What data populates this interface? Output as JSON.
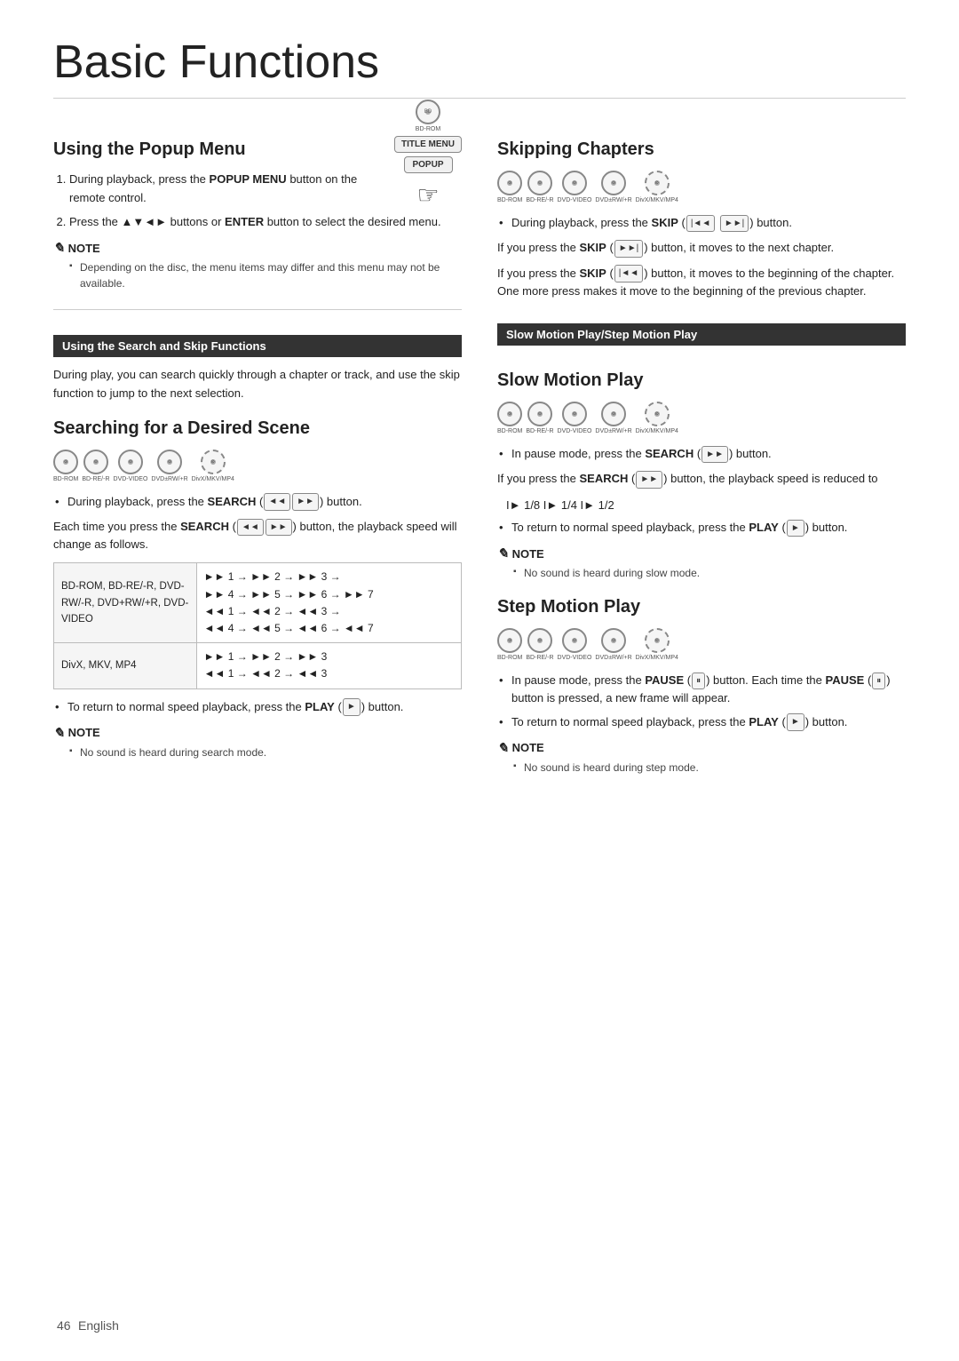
{
  "page": {
    "title": "Basic Functions",
    "footer_page": "46",
    "footer_lang": "English"
  },
  "left": {
    "popup_title": "Using the Popup Menu",
    "popup_steps": [
      {
        "num": "1.",
        "text_before": "During playback, press the ",
        "bold": "POPUP MENU",
        "text_after": " button on the remote control."
      },
      {
        "num": "2.",
        "text_before": "Press the ▲▼◄► buttons or ",
        "bold": "ENTER",
        "text_after": " button to select the desired menu."
      }
    ],
    "popup_note_label": "NOTE",
    "popup_note": "Depending on the disc, the menu items may differ and this menu may not be available.",
    "search_skip_header": "Using the Search and Skip Functions",
    "search_skip_body": "During play, you can search quickly through a chapter or track, and use the skip function to jump to the next selection.",
    "search_title": "Searching for a Desired Scene",
    "search_bullet1_before": "During playback, press the ",
    "search_bullet1_bold": "SEARCH",
    "search_bullet1_after": " (    ) button.",
    "search_each_before": "Each time you press the ",
    "search_each_bold": "SEARCH",
    "search_each_after": " (    ) button, the playback speed will change as follows.",
    "search_table": {
      "row1_label": "BD-ROM, BD-RE/-R, DVD-RW/-R, DVD+RW/+R, DVD-VIDEO",
      "row1_val": "►► 1 → ►► 2 → ►► 3 →\n►► 4 → ►► 5 → ►► 6 → ►► 7\n◄◄ 1 → ◄◄ 2 → ◄◄ 3 →\n◄◄ 4 → ◄◄ 5 → ◄◄ 6 → ◄◄ 7",
      "row2_label": "DivX, MKV, MP4",
      "row2_val": "►► 1 → ►► 2 → ►► 3\n◄◄ 1 → ◄◄ 2 → ◄◄ 3"
    },
    "search_return_before": "To return to normal speed playback, press the ",
    "search_return_bold": "PLAY",
    "search_return_after": " (    ) button.",
    "search_note_label": "NOTE",
    "search_note": "No sound is heard during search mode.",
    "remote_btn1": "TITLE MENU",
    "remote_btn2": "POPUP"
  },
  "right": {
    "skip_title": "Skipping Chapters",
    "skip_bullet1_before": "During playback, press the ",
    "skip_bullet1_bold": "SKIP",
    "skip_bullet1_after": " (    ) button.",
    "skip_para1_before": "If you press the ",
    "skip_para1_bold": "SKIP",
    "skip_para1_mid": " (    ) button, it moves to the next chapter.",
    "skip_para2_before": "If you press the ",
    "skip_para2_bold": "SKIP",
    "skip_para2_mid": " (    ) button, it moves to the beginning of the chapter. One more press makes it move to the beginning of the previous chapter.",
    "slow_motion_header": "Slow Motion Play/Step Motion Play",
    "slow_title": "Slow Motion Play",
    "slow_bullet1_before": "In pause mode, press the ",
    "slow_bullet1_bold": "SEARCH",
    "slow_bullet1_after": " (    ) button.",
    "slow_para1_before": "If you press the ",
    "slow_para1_bold": "SEARCH",
    "slow_para1_mid": " (    ) button, the playback speed is reduced to",
    "slow_speeds": "I► 1/8  I► 1/4  I► 1/2",
    "slow_return_before": "To return to normal speed playback, press the ",
    "slow_return_bold": "PLAY",
    "slow_return_after": " (    ) button.",
    "slow_note_label": "NOTE",
    "slow_note": "No sound is heard during slow mode.",
    "step_title": "Step Motion Play",
    "step_bullet1_before": "In pause mode, press the ",
    "step_bullet1_bold": "PAUSE",
    "step_bullet1_after": " (    ) button. Each time the ",
    "step_bullet1_bold2": "PAUSE",
    "step_bullet1_after2": " (    ) button is pressed, a new frame will appear.",
    "step_return_before": "To return to normal speed playback, press the ",
    "step_return_bold": "PLAY",
    "step_return_after": " (    ) button.",
    "step_note_label": "NOTE",
    "step_note": "No sound is heard during step mode."
  }
}
